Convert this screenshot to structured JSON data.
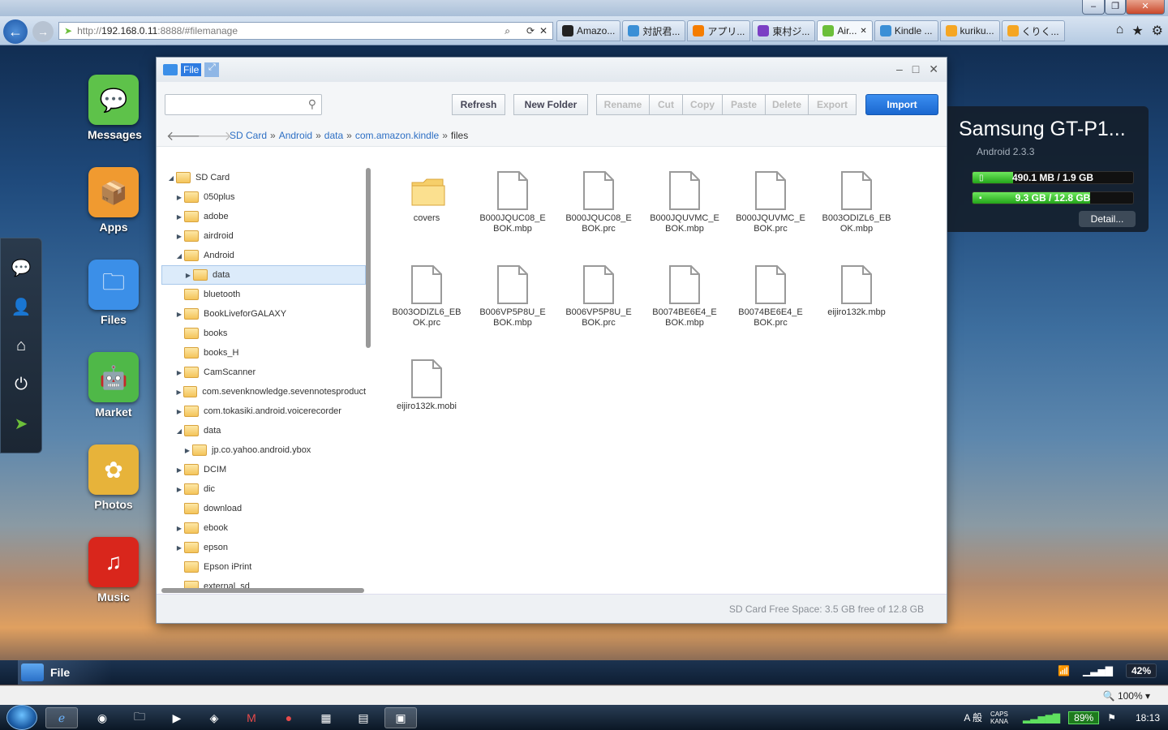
{
  "browser": {
    "url_prefix": "http://",
    "url_host": "192.168.0.11",
    "url_rest": ":8888/#filemanage",
    "tabs": [
      {
        "label": "Amazo...",
        "icon": "amazon-icon",
        "color": "#222222"
      },
      {
        "label": "対訳君...",
        "icon": "ie-icon",
        "color": "#3a8fd6"
      },
      {
        "label": "アプリ...",
        "icon": "blogger-icon",
        "color": "#f57d00"
      },
      {
        "label": "東村ジ...",
        "icon": "site-icon",
        "color": "#7b3fc4"
      },
      {
        "label": "Air...",
        "icon": "airdroid-icon",
        "color": "#6cbf3a"
      },
      {
        "label": "Kindle ...",
        "icon": "ie-icon",
        "color": "#3a8fd6"
      },
      {
        "label": "kuriku...",
        "icon": "s-icon",
        "color": "#f5a623"
      },
      {
        "label": "くりく...",
        "icon": "s-icon",
        "color": "#f5a623"
      }
    ],
    "zoom": "100%"
  },
  "apps": [
    {
      "label": "Messages",
      "icon": "messages-icon",
      "color": "#5ec24a"
    },
    {
      "label": "Apps",
      "icon": "apps-icon",
      "color": "#f09a30"
    },
    {
      "label": "Files",
      "icon": "files-icon",
      "color": "#3b8fe8"
    },
    {
      "label": "Market",
      "icon": "market-icon",
      "color": "#4fb848"
    },
    {
      "label": "Photos",
      "icon": "photos-icon",
      "color": "#e7b33a"
    },
    {
      "label": "Music",
      "icon": "music-icon",
      "color": "#d9261c"
    }
  ],
  "filewin": {
    "title": "File",
    "search_placeholder": "",
    "buttons": {
      "refresh": "Refresh",
      "new_folder": "New Folder",
      "rename": "Rename",
      "cut": "Cut",
      "copy": "Copy",
      "paste": "Paste",
      "delete": "Delete",
      "export": "Export",
      "import": "Import"
    },
    "breadcrumb": [
      "SD Card",
      "Android",
      "data",
      "com.amazon.kindle"
    ],
    "breadcrumb_last": "files",
    "tree": [
      {
        "label": "SD Card",
        "level": 0,
        "toggle": "open"
      },
      {
        "label": "050plus",
        "level": 1,
        "toggle": "closed"
      },
      {
        "label": "adobe",
        "level": 1,
        "toggle": "closed"
      },
      {
        "label": "airdroid",
        "level": 1,
        "toggle": "closed"
      },
      {
        "label": "Android",
        "level": 1,
        "toggle": "open"
      },
      {
        "label": "data",
        "level": 2,
        "toggle": "closed",
        "selected": true
      },
      {
        "label": "bluetooth",
        "level": 1,
        "toggle": "none"
      },
      {
        "label": "BookLiveforGALAXY",
        "level": 1,
        "toggle": "closed"
      },
      {
        "label": "books",
        "level": 1,
        "toggle": "none"
      },
      {
        "label": "books_H",
        "level": 1,
        "toggle": "none"
      },
      {
        "label": "CamScanner",
        "level": 1,
        "toggle": "closed"
      },
      {
        "label": "com.sevenknowledge.sevennotesproduct",
        "level": 1,
        "toggle": "closed"
      },
      {
        "label": "com.tokasiki.android.voicerecorder",
        "level": 1,
        "toggle": "closed"
      },
      {
        "label": "data",
        "level": 1,
        "toggle": "open"
      },
      {
        "label": "jp.co.yahoo.android.ybox",
        "level": 2,
        "toggle": "closed"
      },
      {
        "label": "DCIM",
        "level": 1,
        "toggle": "closed"
      },
      {
        "label": "dic",
        "level": 1,
        "toggle": "closed"
      },
      {
        "label": "download",
        "level": 1,
        "toggle": "none"
      },
      {
        "label": "ebook",
        "level": 1,
        "toggle": "closed"
      },
      {
        "label": "epson",
        "level": 1,
        "toggle": "closed"
      },
      {
        "label": "Epson iPrint",
        "level": 1,
        "toggle": "none"
      },
      {
        "label": "external_sd",
        "level": 1,
        "toggle": "none"
      }
    ],
    "files": [
      {
        "name": "covers",
        "type": "folder"
      },
      {
        "name": "B000JQUC08_EBOK.mbp",
        "type": "file"
      },
      {
        "name": "B000JQUC08_EBOK.prc",
        "type": "file"
      },
      {
        "name": "B000JQUVMC_EBOK.mbp",
        "type": "file"
      },
      {
        "name": "B000JQUVMC_EBOK.prc",
        "type": "file"
      },
      {
        "name": "B003ODIZL6_EBOK.mbp",
        "type": "file"
      },
      {
        "name": "B003ODIZL6_EBOK.prc",
        "type": "file"
      },
      {
        "name": "B006VP5P8U_EBOK.mbp",
        "type": "file"
      },
      {
        "name": "B006VP5P8U_EBOK.prc",
        "type": "file"
      },
      {
        "name": "B0074BE6E4_EBOK.mbp",
        "type": "file"
      },
      {
        "name": "B0074BE6E4_EBOK.prc",
        "type": "file"
      },
      {
        "name": "eijiro132k.mbp",
        "type": "file"
      },
      {
        "name": "eijiro132k.mobi",
        "type": "file"
      }
    ],
    "footer": "SD Card Free Space: 3.5 GB free of 12.8 GB"
  },
  "device": {
    "name": "Samsung GT-P1...",
    "version": "Android 2.3.3",
    "ram_label": "490.1 MB / 1.9 GB",
    "ram_fraction": 0.25,
    "storage_label": "9.3 GB / 12.8 GB",
    "storage_fraction": 0.73,
    "detail": "Detail..."
  },
  "airdroid_taskbar": {
    "item": "File",
    "signal_pct": "42%"
  },
  "tray": {
    "battery": "89%",
    "time": "18:13",
    "ime": "A 般",
    "caps": "CAPS KANA"
  },
  "accent": "#2d7be1"
}
